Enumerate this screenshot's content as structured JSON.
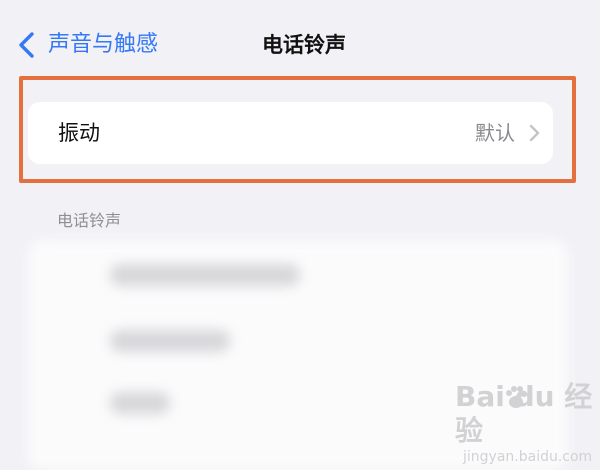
{
  "nav": {
    "back_label": "声音与触感",
    "title": "电话铃声"
  },
  "vibration_row": {
    "label": "振动",
    "value": "默认"
  },
  "ringtones": {
    "section_header": "电话铃声"
  },
  "watermark": {
    "brand": "Bai du 经验",
    "url": "jingyan.baidu.com"
  },
  "colors": {
    "accent": "#3478f6",
    "highlight": "#e5703f",
    "background": "#f2f2f6"
  },
  "icons": [
    "chevron-left-icon",
    "chevron-right-icon",
    "baidu-paw-icon"
  ]
}
